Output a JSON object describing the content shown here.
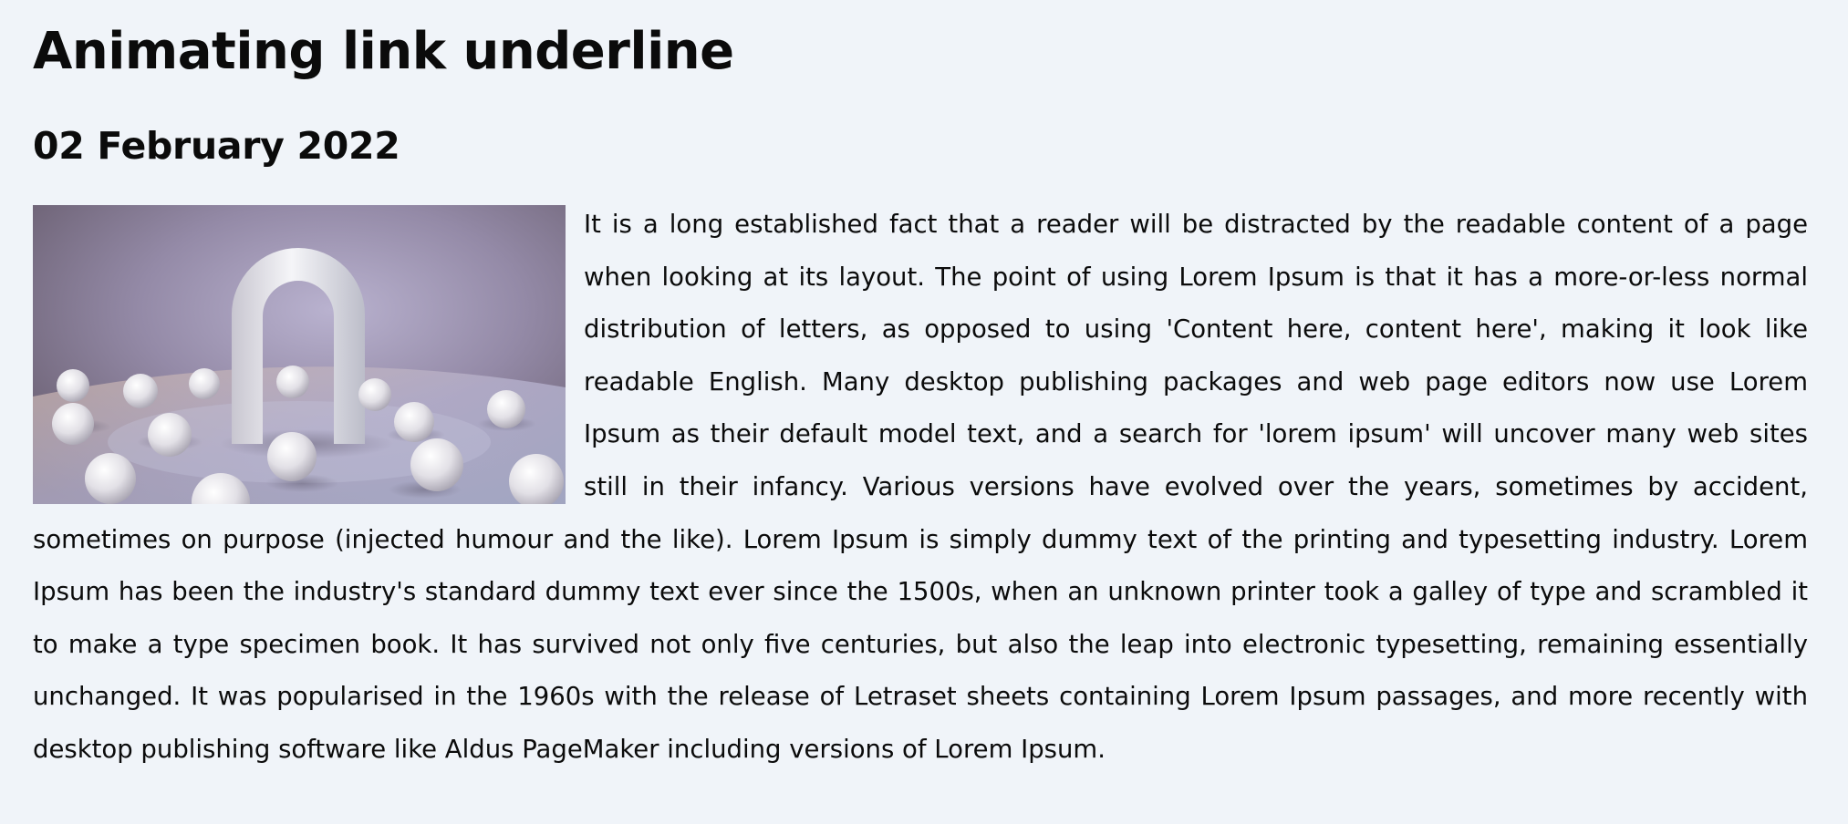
{
  "article": {
    "title": "Animating link underline",
    "date": "02 February 2022",
    "body": "It is a long established fact that a reader will be distracted by the readable content of a page when looking at its layout. The point of using Lorem Ipsum is that it has a more-or-less normal distribution of letters, as opposed to using 'Content here, content here', making it look like readable English. Many desktop publishing packages and web page editors now use Lorem Ipsum as their default model text, and a search for 'lorem ipsum' will uncover many web sites still in their infancy. Various versions have evolved over the years, sometimes by accident, sometimes on purpose (injected humour and the like). Lorem Ipsum is simply dummy text of the printing and typesetting industry. Lorem Ipsum has been the industry's standard dummy text ever since the 1500s, when an unknown printer took a galley of type and scrambled it to make a type specimen book. It has survived not only five centuries, but also the leap into electronic typesetting, remaining essentially unchanged. It was popularised in the 1960s with the release of Letraset sheets containing Lorem Ipsum passages, and more recently with desktop publishing software like Aldus PageMaker including versions of Lorem Ipsum."
  },
  "colors": {
    "background": "#f0f4f9",
    "text": "#0b0b0b"
  }
}
